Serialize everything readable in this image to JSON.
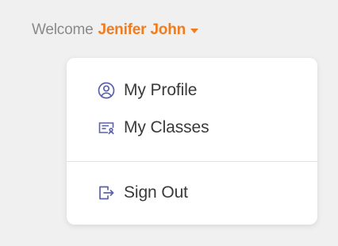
{
  "header": {
    "welcome_text": "Welcome",
    "user_name": "Jenifer John",
    "caret_icon": "caret-down-icon"
  },
  "menu": {
    "items": [
      {
        "label": "My Profile",
        "icon": "user-circle-icon"
      },
      {
        "label": "My Classes",
        "icon": "classes-card-icon"
      },
      {
        "label": "Sign Out",
        "icon": "sign-out-icon"
      }
    ]
  },
  "colors": {
    "background": "#f0f0f0",
    "accent": "#f07c1e",
    "welcome_text": "#8a8a8a",
    "menu_text": "#3a3a3a",
    "icon": "#5b61a8"
  }
}
